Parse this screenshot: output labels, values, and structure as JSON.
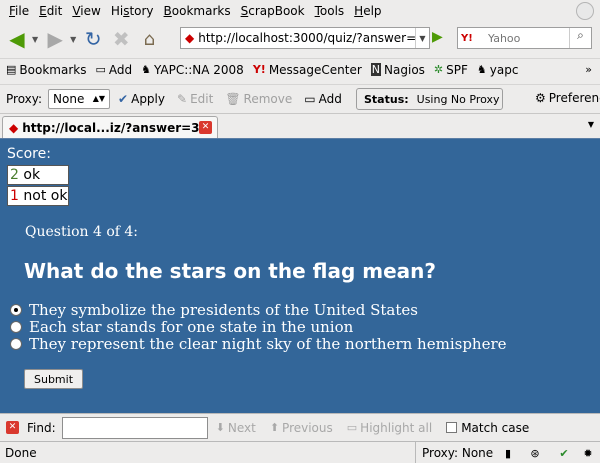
{
  "menu": [
    "File",
    "Edit",
    "View",
    "History",
    "Bookmarks",
    "ScrapBook",
    "Tools",
    "Help"
  ],
  "menu_accel": [
    "F",
    "E",
    "V",
    "s",
    "B",
    "S",
    "T",
    "H"
  ],
  "nav": {
    "url": "http://localhost:3000/quiz/?answer=3",
    "search_placeholder": "Yahoo",
    "search_engine": "Y!"
  },
  "bookmarks": {
    "items": [
      {
        "label": "Bookmarks",
        "icon": "bookmarks-icon"
      },
      {
        "label": "Add",
        "icon": "page-icon"
      },
      {
        "label": "YAPC::NA 2008",
        "icon": "camel-icon"
      },
      {
        "label": "MessageCenter",
        "icon": "yahoo-icon"
      },
      {
        "label": "Nagios",
        "icon": "nagios-icon"
      },
      {
        "label": "SPF",
        "icon": "spf-icon"
      },
      {
        "label": "yapc",
        "icon": "camel-icon"
      }
    ],
    "more": "»"
  },
  "proxy": {
    "label": "Proxy:",
    "selected": "None",
    "apply": "Apply",
    "edit": "Edit",
    "remove": "Remove",
    "add": "Add",
    "status_label": "Status:",
    "status_value": "Using No Proxy",
    "preferences": "Preferences"
  },
  "tab": {
    "title": "http://local...iz/?answer=3"
  },
  "quiz": {
    "score_label": "Score:",
    "ok_count": "2",
    "ok_text": "ok",
    "nok_count": "1",
    "nok_text": "not ok",
    "question_number": "Question 4 of 4:",
    "question": "What do the stars on the flag mean?",
    "answers": [
      "They symbolize the presidents of the United States",
      "Each star stands for one state in the union",
      "They represent the clear night sky of the northern hemisphere"
    ],
    "selected_answer": 0,
    "submit": "Submit"
  },
  "find": {
    "label": "Find:",
    "value": "",
    "next": "Next",
    "previous": "Previous",
    "highlight_all": "Highlight all",
    "match_case": "Match case"
  },
  "status": {
    "text": "Done",
    "proxy": "Proxy: None"
  }
}
